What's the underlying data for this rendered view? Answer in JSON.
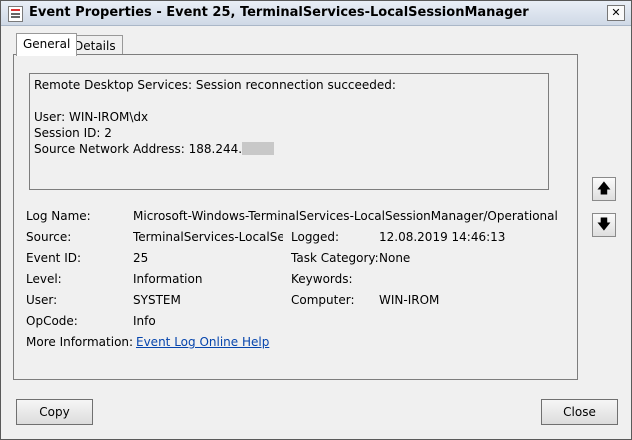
{
  "window": {
    "title": "Event Properties - Event 25, TerminalServices-LocalSessionManager"
  },
  "tabs": [
    "General",
    "Details"
  ],
  "description": {
    "line1": "Remote Desktop Services: Session reconnection succeeded:",
    "user": "User: WIN-IROM\\dx",
    "session": "Session ID: 2",
    "source_addr": "Source Network Address: 188.244."
  },
  "fields": {
    "log_name": {
      "label": "Log Name:",
      "value": "Microsoft-Windows-TerminalServices-LocalSessionManager/Operational"
    },
    "source": {
      "label": "Source:",
      "value": "TerminalServices-LocalSessi"
    },
    "logged": {
      "label": "Logged:",
      "value": "12.08.2019 14:46:13"
    },
    "event_id": {
      "label": "Event ID:",
      "value": "25"
    },
    "task_category": {
      "label": "Task Category:",
      "value": "None"
    },
    "level": {
      "label": "Level:",
      "value": "Information"
    },
    "keywords": {
      "label": "Keywords:",
      "value": ""
    },
    "user": {
      "label": "User:",
      "value": "SYSTEM"
    },
    "computer": {
      "label": "Computer:",
      "value": "WIN-IROM"
    },
    "opcode": {
      "label": "OpCode:",
      "value": "Info"
    },
    "more_info": {
      "label": "More Information:",
      "value": "Event Log Online Help"
    }
  },
  "buttons": {
    "copy": "Copy",
    "close": "Close"
  },
  "icons": {
    "up": "up-arrow-icon",
    "down": "down-arrow-icon",
    "close": "close-icon"
  }
}
